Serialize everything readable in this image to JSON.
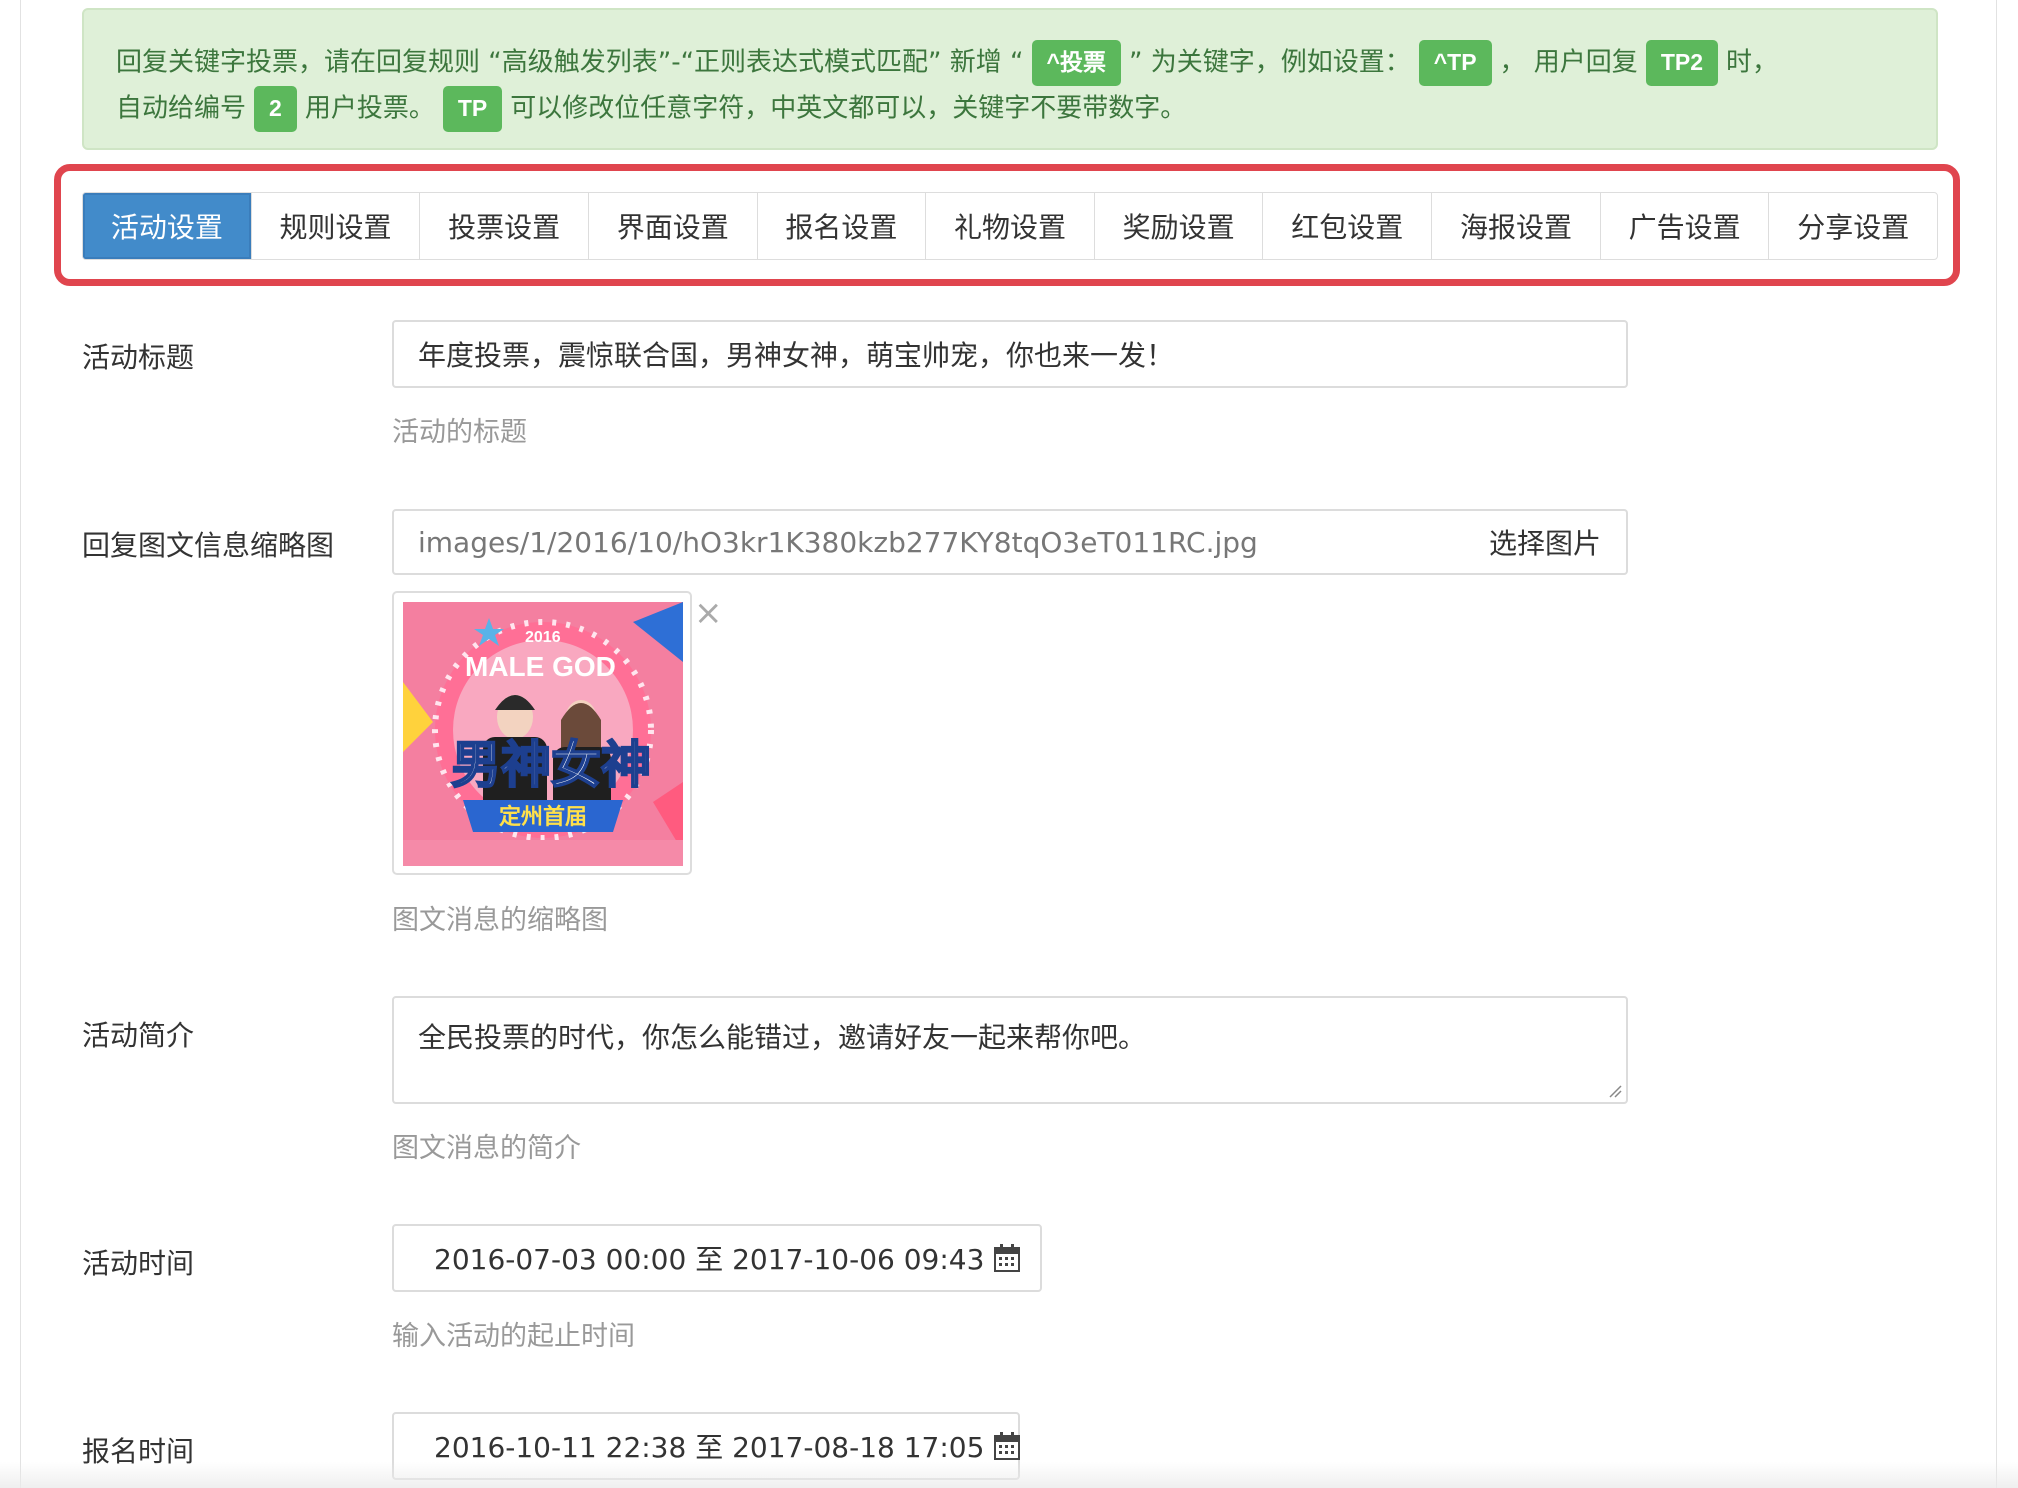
{
  "alert": {
    "line1": {
      "t1": "回复关键字投票，请在回复规则 “高级触发列表”-“正则表达式模式匹配” 新增 “",
      "k1": "^投票",
      "t2": "” 为关键字，例如设置：",
      "k2": "^TP",
      "t3": "，  用户回复",
      "k3": "TP2",
      "t4": "时，"
    },
    "line2": {
      "t1": "自动给编号",
      "k1": "2",
      "t2": "用户投票。",
      "k2": "TP",
      "t3": "可以修改位任意字符，中英文都可以，关键字不要带数字。"
    }
  },
  "tabs": [
    {
      "label": "活动设置",
      "active": true
    },
    {
      "label": "规则设置"
    },
    {
      "label": "投票设置"
    },
    {
      "label": "界面设置"
    },
    {
      "label": "报名设置"
    },
    {
      "label": "礼物设置"
    },
    {
      "label": "奖励设置"
    },
    {
      "label": "红包设置"
    },
    {
      "label": "海报设置"
    },
    {
      "label": "广告设置"
    },
    {
      "label": "分享设置"
    }
  ],
  "form": {
    "title": {
      "label": "活动标题",
      "value": "年度投票，震惊联合国，男神女神，萌宝帅宠，你也来一发！",
      "help": "活动的标题"
    },
    "thumb": {
      "label": "回复图文信息缩略图",
      "value": "images/1/2016/10/hO3kr1K380kzb277KY8tqO3eT011RC.jpg",
      "button": "选择图片",
      "remove": "×",
      "help": "图文消息的缩略图",
      "image_text": {
        "year": "2016",
        "banner": "MALE GOD",
        "main": "男神女神",
        "ribbon": "定州首届"
      }
    },
    "intro": {
      "label": "活动简介",
      "value": "全民投票的时代，你怎么能错过，邀请好友一起来帮你吧。",
      "help": "图文消息的简介"
    },
    "time": {
      "label": "活动时间",
      "value": "2016-07-03 00:00 至 2017-10-06 09:43",
      "help": "输入活动的起止时间"
    },
    "signup": {
      "label": "报名时间",
      "value": "2016-10-11 22:38 至 2017-08-18 17:05"
    }
  },
  "colors": {
    "alert_bg": "#dff0d8",
    "alert_text": "#3c763d",
    "keyword_badge": "#5cb85c",
    "tab_active": "#428bca",
    "highlight_border": "#e0454e"
  }
}
